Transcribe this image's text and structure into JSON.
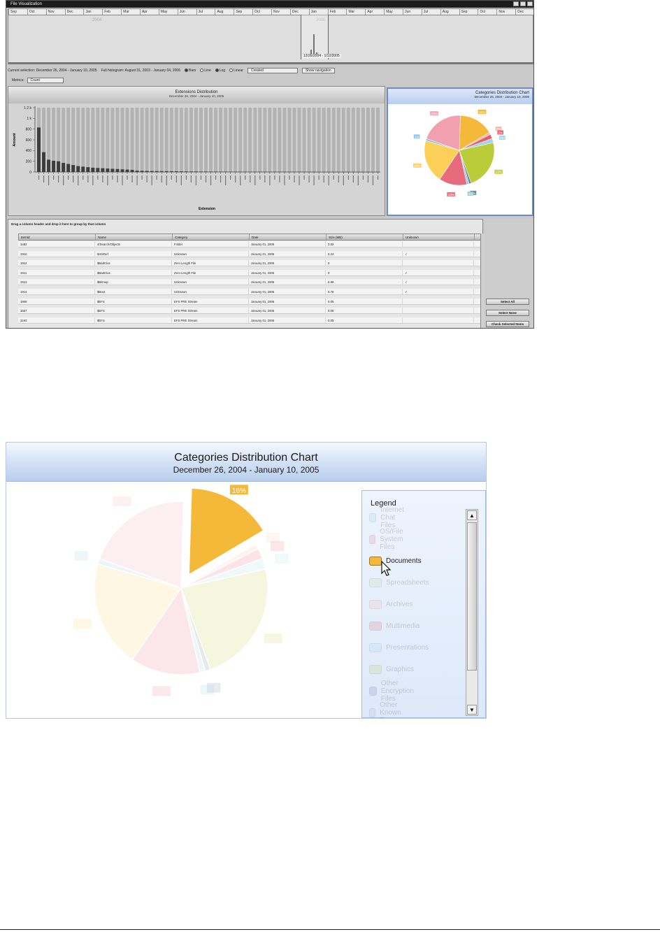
{
  "window": {
    "title": "File Visualization"
  },
  "timeline": {
    "months": [
      "Sep",
      "Oct",
      "Nov",
      "Dec",
      "Jan",
      "Feb",
      "Mar",
      "Apr",
      "May",
      "Jun",
      "Jul",
      "Aug",
      "Sep",
      "Oct",
      "Nov",
      "Dec",
      "Jan",
      "Feb",
      "Mar",
      "Apr",
      "May",
      "Jun",
      "Jul",
      "Aug",
      "Sep",
      "Oct",
      "Nov",
      "Dec"
    ],
    "years": [
      "2004",
      "2005"
    ],
    "selection_label": "12/26/2004 - 1/12/2005"
  },
  "controls": {
    "current_selection": "Current selection: December 26, 2004 - January 10, 2005",
    "full_histogram": "Full histogram: August 31, 2003 - January 04, 2006",
    "scale_options": [
      "Bars",
      "Line"
    ],
    "axis_options": [
      "Log",
      "Linear"
    ],
    "date_field": "Created",
    "show_navigation": "Show navigation",
    "metrics_label": "Metrics:",
    "metrics_value": "Count"
  },
  "extensions_panel": {
    "title": "Extensions Distribution",
    "subtitle": "December 26, 2004 - January 10, 2005",
    "ylabel": "Amount",
    "xlabel": "Extension",
    "yticks": [
      "1.2 k",
      "1 k",
      "800",
      "600",
      "400",
      "200",
      "0"
    ]
  },
  "chart_data": [
    {
      "type": "bar",
      "title": "Extensions Distribution",
      "subtitle": "December 26, 2004 - January 10, 2005",
      "xlabel": "Extension",
      "ylabel": "Amount",
      "ylim": [
        0,
        1200
      ],
      "values": [
        830,
        370,
        230,
        210,
        200,
        170,
        150,
        130,
        110,
        100,
        90,
        80,
        75,
        70,
        65,
        60,
        55,
        50,
        45,
        40,
        25,
        22,
        20,
        18,
        17,
        16,
        15,
        14,
        13,
        12,
        11,
        10,
        10,
        9,
        9,
        8,
        8,
        7,
        7,
        6,
        6,
        5,
        5,
        5,
        4,
        4,
        4,
        3,
        3,
        3,
        3,
        2,
        2,
        2,
        2,
        2,
        1,
        1,
        1,
        1,
        1,
        1,
        1,
        1,
        1,
        1,
        1,
        1,
        1,
        1
      ]
    },
    {
      "type": "pie",
      "title": "Categories Distribution Chart",
      "subtitle": "December 26, 2004 - January 10, 2005",
      "series": [
        {
          "name": "Documents",
          "value": 16,
          "label": "16%",
          "color": "#f5b93a"
        },
        {
          "name": "Spreadsheets",
          "value": 1,
          "label": "1%",
          "color": "#f6b8a2"
        },
        {
          "name": "Archives",
          "value": 2,
          "label": "2%",
          "color": "#e85a6a"
        },
        {
          "name": "Presentations",
          "value": 2,
          "label": "2%",
          "color": "#9fd6e8"
        },
        {
          "name": "Graphics",
          "value": 23,
          "label": "23%",
          "color": "#bccb3a"
        },
        {
          "name": "Other Encryption Files",
          "value": 1,
          "label": "1%",
          "color": "#6b7d99"
        },
        {
          "name": "Multimedia",
          "value": 1,
          "label": "1%",
          "color": "#8fd0de"
        },
        {
          "name": "OS/File System Files",
          "value": 13,
          "label": "13%",
          "color": "#e76b7c"
        },
        {
          "name": "Unknown",
          "value": 20,
          "label": "20%",
          "color": "#fbcf58"
        },
        {
          "name": "Internet Chat Files",
          "value": 1,
          "label": "1%",
          "color": "#8fc3ee"
        },
        {
          "name": "Folder",
          "value": 20,
          "label": "20%",
          "color": "#f1a0b0"
        }
      ]
    }
  ],
  "grid": {
    "group_hint": "Drag a column header and drop it here to group by that column",
    "columns": [
      "ItemId",
      "Name",
      "Category",
      "Date",
      "Size (MB)",
      "Unknown"
    ],
    "rows": [
      [
        "1482",
        "4/Search/Objects",
        "Folder",
        "January 01, 2005",
        "0.02",
        ""
      ],
      [
        "1910",
        "$AttrDef",
        "Unknown",
        "January 01, 2005",
        "0.24",
        "✓"
      ],
      [
        "1912",
        "$BadClus",
        "Zero Length File",
        "January 01, 2005",
        "0",
        ""
      ],
      [
        "1911",
        "$BadClus",
        "Zero Length File",
        "January 01, 2005",
        "0",
        "✓"
      ],
      [
        "1913",
        "$Bitmap",
        "Unknown",
        "January 01, 2005",
        "2.99",
        "✓"
      ],
      [
        "1914",
        "$Boot",
        "Unknown",
        "January 01, 2005",
        "0.78",
        "✓"
      ],
      [
        "1908",
        "$EFS",
        "EFS PRE Stream",
        "January 01, 2005",
        "0.05",
        ""
      ],
      [
        "1657",
        "$EFS",
        "EFS PRE Stream",
        "January 01, 2005",
        "0.05",
        ""
      ],
      [
        "3163",
        "$EFS",
        "EFS PRE Stream",
        "January 01, 2005",
        "0.05",
        ""
      ]
    ]
  },
  "side_buttons": {
    "select_all": "Select All",
    "select_none": "Select None",
    "check_selected": "Check Selected Items"
  },
  "zoom": {
    "title": "Categories Distribution Chart",
    "subtitle": "December 26, 2004 - January 10, 2005",
    "legend_title": "Legend",
    "legend_items": [
      {
        "label": "Internet Chat Files",
        "color": "#8fc3ee",
        "highlight": false
      },
      {
        "label": "OS/File System Files",
        "color": "#e76b7c",
        "highlight": false
      },
      {
        "label": "Documents",
        "color": "#f5b93a",
        "highlight": true
      },
      {
        "label": "Spreadsheets",
        "color": "#bcdc88",
        "highlight": false
      },
      {
        "label": "Archives",
        "color": "#f6b8a2",
        "highlight": false
      },
      {
        "label": "Multimedia",
        "color": "#e85a6a",
        "highlight": false
      },
      {
        "label": "Presentations",
        "color": "#9fd6e8",
        "highlight": false
      },
      {
        "label": "Graphics",
        "color": "#bccb3a",
        "highlight": false
      },
      {
        "label": "Other Encryption Files",
        "color": "#6b7d99",
        "highlight": false
      },
      {
        "label": "Other Known Types",
        "color": "#a9b7c9",
        "highlight": false
      }
    ]
  }
}
